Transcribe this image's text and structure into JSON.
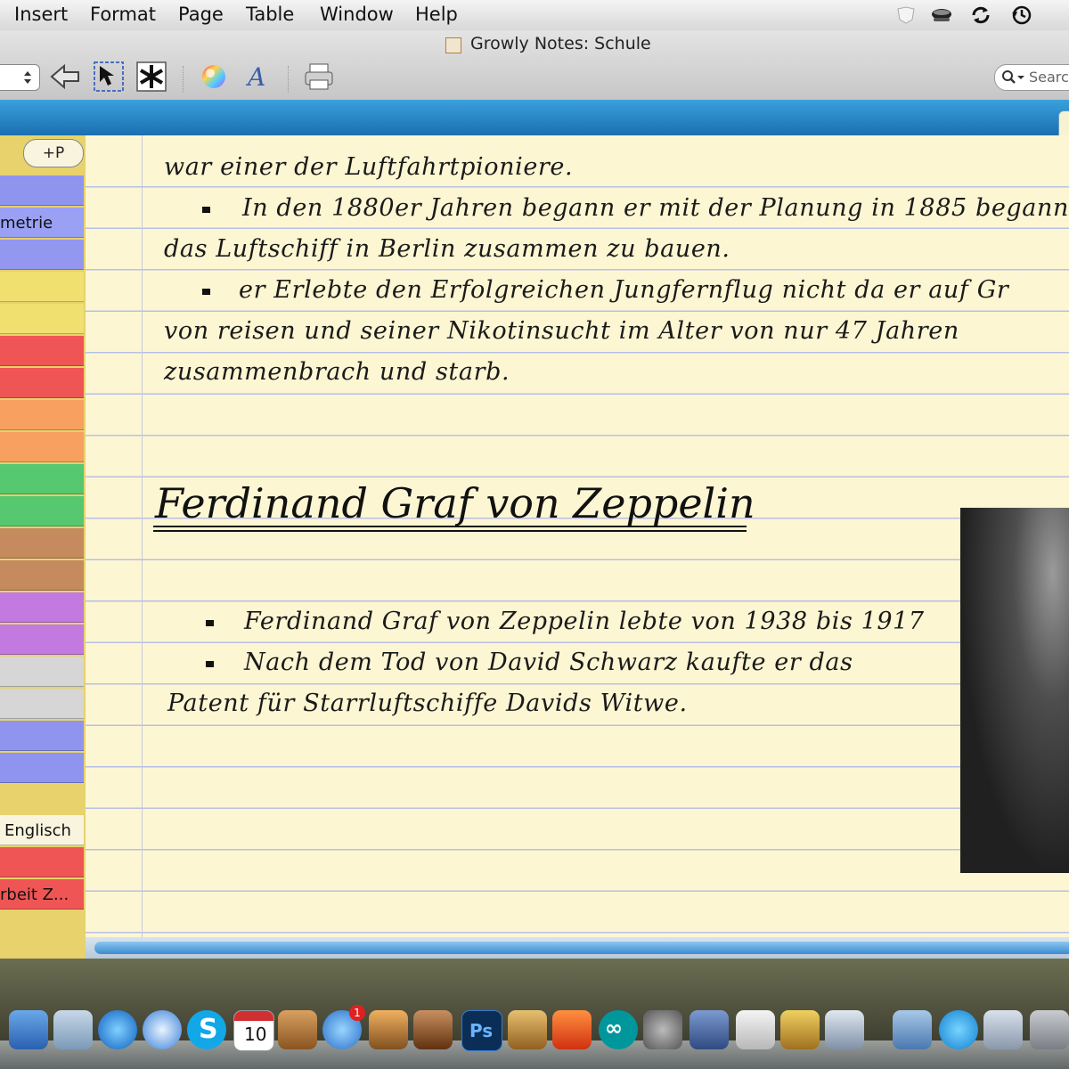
{
  "menubar": {
    "items": [
      "Insert",
      "Format",
      "Page",
      "Table",
      "Window",
      "Help"
    ]
  },
  "window": {
    "title": "Growly Notes: Schule"
  },
  "toolbar": {
    "search_placeholder": "Search"
  },
  "sidebar": {
    "add_page_label": "+P",
    "tabs": [
      {
        "label": "",
        "color": "#8f95ef"
      },
      {
        "label": "metrie",
        "color": "#9aa0f3"
      },
      {
        "label": "",
        "color": "#9397ef"
      },
      {
        "label": "",
        "color": "#efe070"
      },
      {
        "label": "",
        "color": "#efe070"
      },
      {
        "label": "",
        "color": "#f05555"
      },
      {
        "label": "",
        "color": "#f05555"
      },
      {
        "label": "",
        "color": "#f8a060"
      },
      {
        "label": "",
        "color": "#f8a060"
      },
      {
        "label": "",
        "color": "#55c870"
      },
      {
        "label": "",
        "color": "#55c870"
      },
      {
        "label": "",
        "color": "#c58a5e"
      },
      {
        "label": "",
        "color": "#c58a5e"
      },
      {
        "label": "",
        "color": "#c27ae0"
      },
      {
        "label": "",
        "color": "#c27ae0"
      },
      {
        "label": "",
        "color": "#d6d6d6"
      },
      {
        "label": "",
        "color": "#d6d6d6"
      },
      {
        "label": "",
        "color": "#8f95ef"
      },
      {
        "label": "",
        "color": "#8f95ef"
      },
      {
        "label": "Englisch",
        "color": "#f9f4de"
      },
      {
        "label": "",
        "color": "#f05555"
      },
      {
        "label": "rbeit Z...",
        "color": "#f05555"
      }
    ]
  },
  "note": {
    "lines": [
      "war einer der Luftfahrtpioniere.",
      "In den 1880er Jahren begann er mit der Planung in 1885 begann",
      "das Luftschiff in Berlin zusammen zu bauen.",
      "er Erlebte den Erfolgreichen Jungfernflug nicht da er auf Gr",
      "von reisen und seiner Nikotinsucht im Alter von nur 47 Jahren",
      "zusammenbrach und starb."
    ],
    "heading": "Ferdinand Graf von Zeppelin",
    "lines2": [
      "Ferdinand Graf von Zeppelin lebte von 1938 bis 1917",
      "Nach dem Tod von David Schwarz kaufte er das",
      "Patent für Starrluftschiffe Davids Witwe."
    ]
  },
  "dock": {
    "calendar_day": "10",
    "appstore_badge": "1",
    "photoshop_label": "Ps"
  }
}
